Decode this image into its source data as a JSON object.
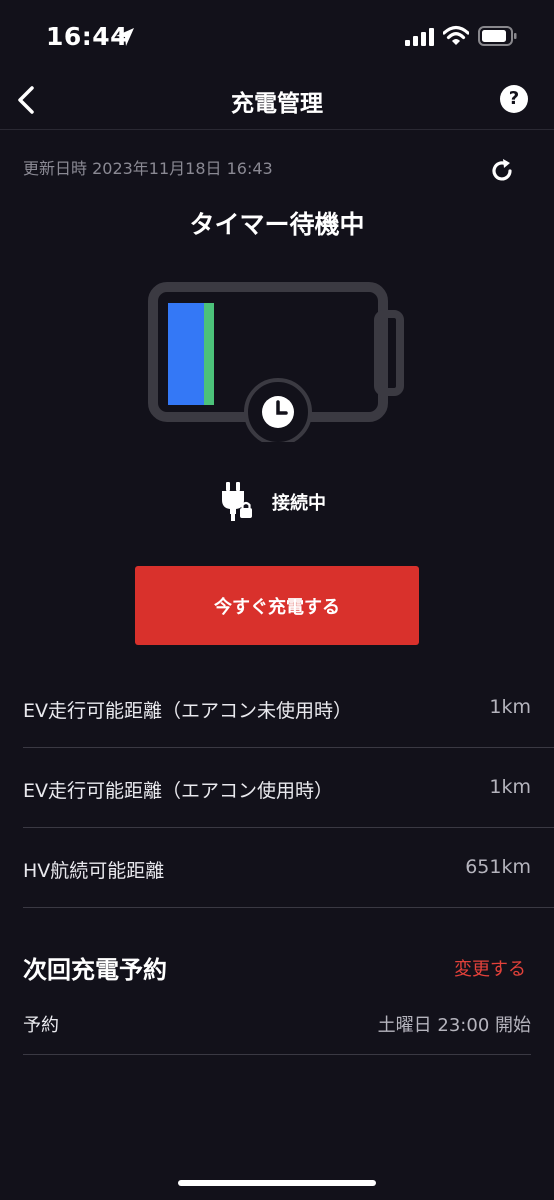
{
  "status_bar": {
    "time": "16:44",
    "icons": [
      "location-arrow-icon",
      "cellular-signal-icon",
      "wifi-icon",
      "battery-icon"
    ]
  },
  "nav": {
    "title": "充電管理",
    "back_icon": "chevron-left-icon",
    "help_label": "?"
  },
  "updated": {
    "text": "更新日時 2023年11月18日 16:43",
    "refresh_icon": "refresh-icon"
  },
  "status": {
    "title": "タイマー待機中",
    "battery_level": 0.23,
    "connection": "接続中",
    "connection_icon": "plug-lock-icon",
    "timer_icon": "clock-icon"
  },
  "actions": {
    "charge_now": "今すぐ充電する"
  },
  "ranges": [
    {
      "label": "EV走行可能距離（エアコン未使用時）",
      "value": "1km"
    },
    {
      "label": "EV走行可能距離（エアコン使用時）",
      "value": "1km"
    },
    {
      "label": "HV航続可能距離",
      "value": "651km"
    }
  ],
  "schedule": {
    "title": "次回充電予約",
    "change_label": "変更する",
    "row_label": "予約",
    "row_value": "土曜日 23:00 開始"
  },
  "colors": {
    "background": "#12111a",
    "accent_red": "#d9312c",
    "link_red": "#e2413a",
    "battery_blue": "#3478f6",
    "battery_green": "#4cc27a"
  }
}
